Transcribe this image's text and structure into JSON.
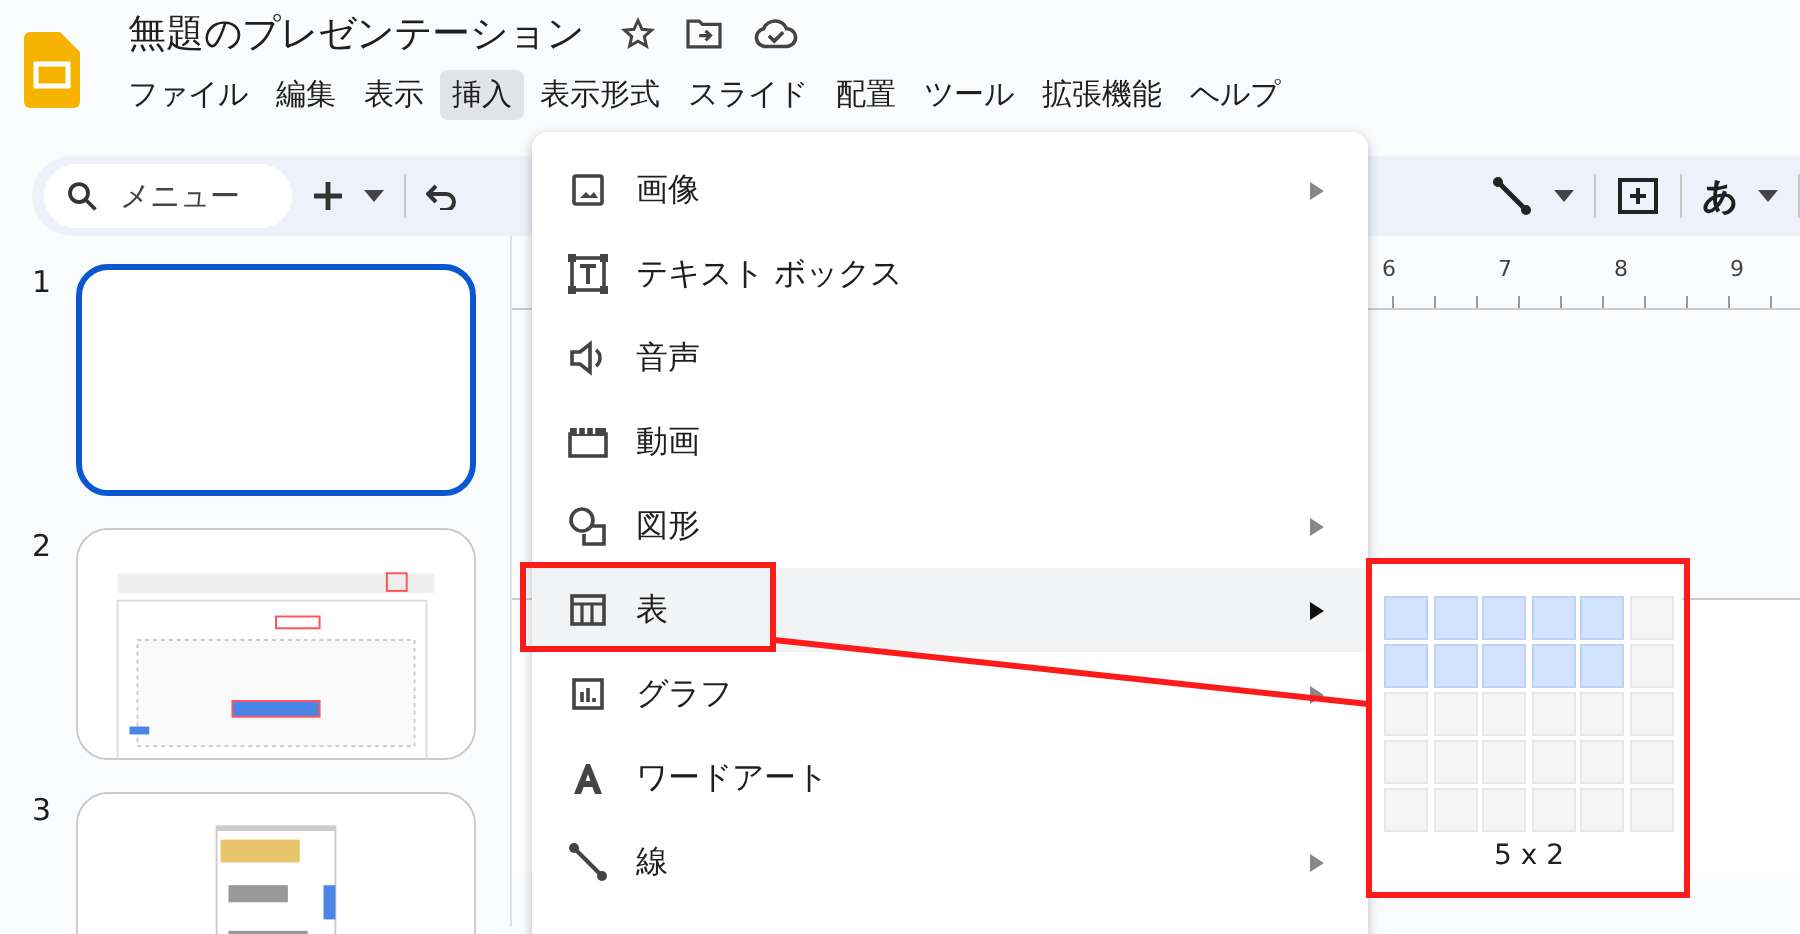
{
  "document": {
    "title": "無題のプレゼンテーション"
  },
  "menubar": [
    {
      "label": "ファイル",
      "selected": false
    },
    {
      "label": "編集",
      "selected": false
    },
    {
      "label": "表示",
      "selected": false
    },
    {
      "label": "挿入",
      "selected": true
    },
    {
      "label": "表示形式",
      "selected": false
    },
    {
      "label": "スライド",
      "selected": false
    },
    {
      "label": "配置",
      "selected": false
    },
    {
      "label": "ツール",
      "selected": false
    },
    {
      "label": "拡張機能",
      "selected": false
    },
    {
      "label": "ヘルプ",
      "selected": false
    }
  ],
  "toolbar": {
    "search_placeholder": "メニュー",
    "font_button": "あ"
  },
  "ruler": [
    "6",
    "7",
    "8",
    "9"
  ],
  "slides": [
    {
      "number": "1",
      "selected": true,
      "kind": "blank"
    },
    {
      "number": "2",
      "selected": false,
      "kind": "picture"
    },
    {
      "number": "3",
      "selected": false,
      "kind": "picture"
    }
  ],
  "insert_menu": [
    {
      "label": "画像",
      "has_submenu": true,
      "selected": false
    },
    {
      "label": "テキスト ボックス",
      "has_submenu": false,
      "selected": false
    },
    {
      "label": "音声",
      "has_submenu": false,
      "selected": false
    },
    {
      "label": "動画",
      "has_submenu": false,
      "selected": false
    },
    {
      "label": "図形",
      "has_submenu": true,
      "selected": false
    },
    {
      "label": "表",
      "has_submenu": true,
      "selected": true
    },
    {
      "label": "グラフ",
      "has_submenu": true,
      "selected": false
    },
    {
      "label": "ワードアート",
      "has_submenu": false,
      "selected": false
    },
    {
      "label": "線",
      "has_submenu": true,
      "selected": false
    }
  ],
  "table_picker": {
    "rows": [
      {
        "cells": [
          {
            "selected": true
          },
          {
            "selected": true
          },
          {
            "selected": true
          },
          {
            "selected": true
          },
          {
            "selected": true
          },
          {
            "selected": false
          }
        ]
      },
      {
        "cells": [
          {
            "selected": true
          },
          {
            "selected": true
          },
          {
            "selected": true
          },
          {
            "selected": true
          },
          {
            "selected": true
          },
          {
            "selected": false
          }
        ]
      },
      {
        "cells": [
          {
            "selected": false
          },
          {
            "selected": false
          },
          {
            "selected": false
          },
          {
            "selected": false
          },
          {
            "selected": false
          },
          {
            "selected": false
          }
        ]
      },
      {
        "cells": [
          {
            "selected": false
          },
          {
            "selected": false
          },
          {
            "selected": false
          },
          {
            "selected": false
          },
          {
            "selected": false
          },
          {
            "selected": false
          }
        ]
      },
      {
        "cells": [
          {
            "selected": false
          },
          {
            "selected": false
          },
          {
            "selected": false
          },
          {
            "selected": false
          },
          {
            "selected": false
          },
          {
            "selected": false
          }
        ]
      }
    ],
    "size_label": "5 x 2"
  }
}
